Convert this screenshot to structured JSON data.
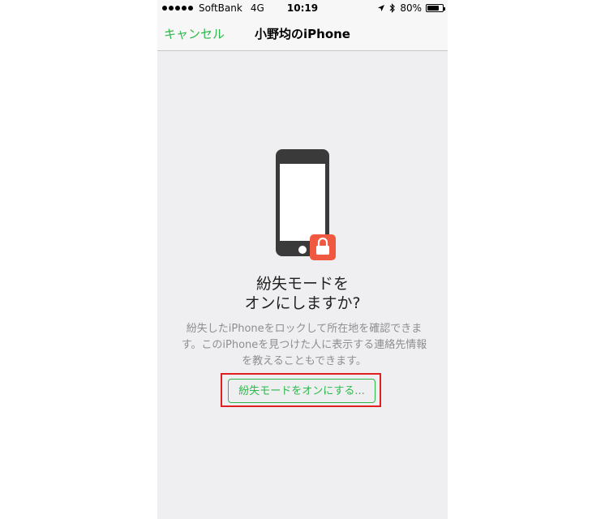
{
  "status_bar": {
    "carrier": "SoftBank",
    "network": "4G",
    "time": "10:19",
    "battery": "80%",
    "battery_level": 0.8,
    "icons": [
      "location-arrow-icon",
      "bluetooth-icon",
      "battery-icon"
    ]
  },
  "nav": {
    "cancel_label": "キャンセル",
    "title": "小野均のiPhone"
  },
  "content": {
    "heading_line1": "紛失モードを",
    "heading_line2": "オンにしますか?",
    "description_line1": "紛失したiPhoneをロックして所在地を確認できま",
    "description_line2": "す。このiPhoneを見つけた人に表示する連絡先情報",
    "description_line3": "を教えることもできます。",
    "action_button_label": "紛失モードをオンにする..."
  },
  "colors": {
    "accent_green": "#2eb84b",
    "lock_badge": "#f0583f",
    "phone_body": "#3a3a3a",
    "highlight_red": "#e02020",
    "background": "#efeff1"
  }
}
